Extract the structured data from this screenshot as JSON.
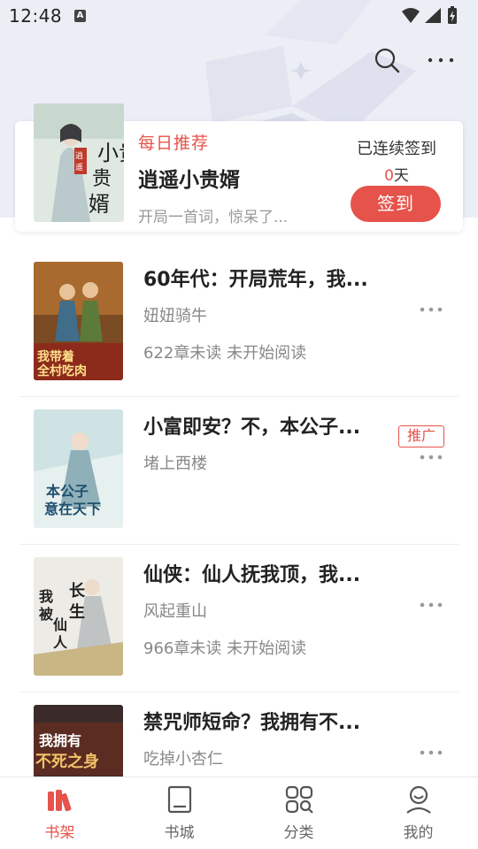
{
  "status_bar": {
    "time": "12:48",
    "notification_letter": "A"
  },
  "header": {
    "actions": [
      {
        "name": "search-icon"
      },
      {
        "name": "more-icon"
      }
    ]
  },
  "checkin": {
    "tag": "每日推荐",
    "book_title": "逍遥小贵婿",
    "book_desc": "开局一首词，惊呆了...",
    "cover_text": "小贵婿",
    "cover_badge": "逍遥",
    "streak_label": "已连续签到",
    "streak_count": "0",
    "streak_unit": "天",
    "button_label": "签到"
  },
  "books": [
    {
      "title": "60年代：开局荒年，我...",
      "author": "妞妞骑牛",
      "progress": "622章未读 未开始阅读",
      "cover_text": "我带着全村吃肉",
      "promoted": false
    },
    {
      "title": "小富即安？不，本公子...",
      "author": "堵上西楼",
      "progress": "",
      "cover_text": "本公子意在天下",
      "promoted": true,
      "badge": "推广"
    },
    {
      "title": "仙侠：仙人抚我顶，我...",
      "author": "风起重山",
      "progress": "966章未读 未开始阅读",
      "cover_text": "我被仙人长生",
      "promoted": false
    },
    {
      "title": "禁咒师短命？我拥有不...",
      "author": "吃掉小杏仁",
      "progress": "",
      "cover_text": "我拥有不死之身",
      "promoted": false
    }
  ],
  "tabs": [
    {
      "label": "书架",
      "icon": "bookshelf-icon",
      "active": true
    },
    {
      "label": "书城",
      "icon": "bookstore-icon",
      "active": false
    },
    {
      "label": "分类",
      "icon": "category-icon",
      "active": false
    },
    {
      "label": "我的",
      "icon": "profile-icon",
      "active": false
    }
  ],
  "colors": {
    "accent": "#e5534b",
    "header_bg": "#eceef6",
    "muted_text": "#888888"
  }
}
